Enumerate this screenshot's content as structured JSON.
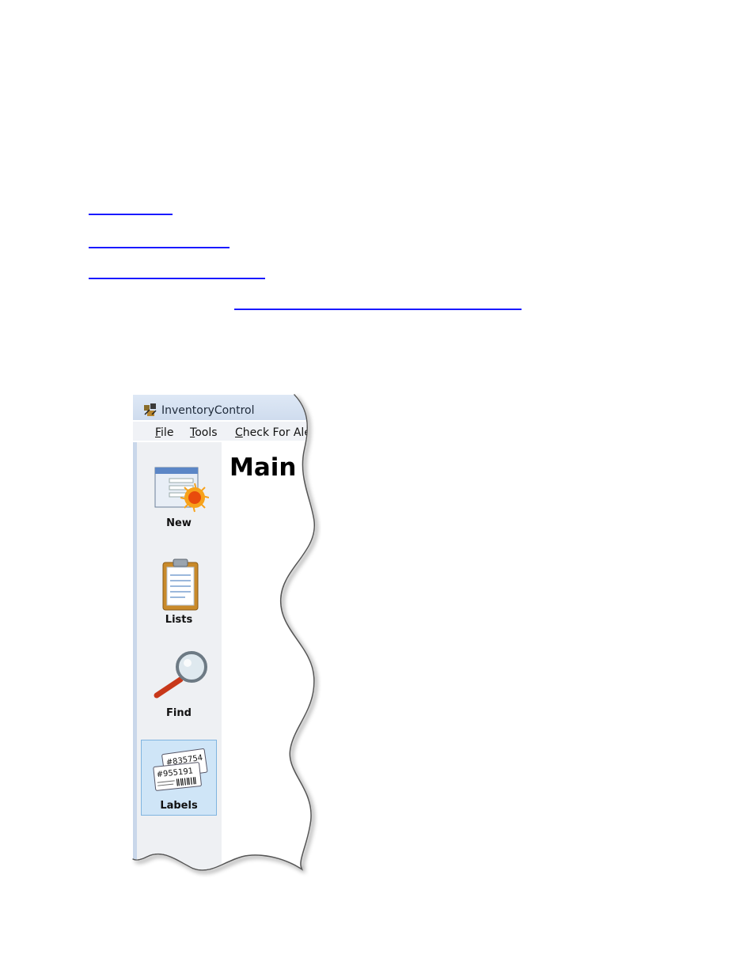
{
  "window": {
    "title": "InventoryControl",
    "title_icon": "inventory-control-app-icon"
  },
  "menubar": {
    "items": [
      {
        "mnemonic": "F",
        "rest": "ile"
      },
      {
        "mnemonic": "T",
        "rest": "ools"
      },
      {
        "mnemonic": "C",
        "rest": "heck For Aler"
      }
    ]
  },
  "sidebar": {
    "items": [
      {
        "label": "New",
        "icon": "new-form-icon"
      },
      {
        "label": "Lists",
        "icon": "clipboard-icon"
      },
      {
        "label": "Find",
        "icon": "magnifier-icon"
      },
      {
        "label": "Labels",
        "icon": "barcode-labels-icon",
        "selected": true,
        "label_text_1": "#835754",
        "label_text_2": "#955191"
      }
    ]
  },
  "main": {
    "title": "Main"
  },
  "colors": {
    "link": "#1a1aff",
    "selected_bg": "#cfe5f7",
    "selected_border": "#7fb4e0"
  }
}
